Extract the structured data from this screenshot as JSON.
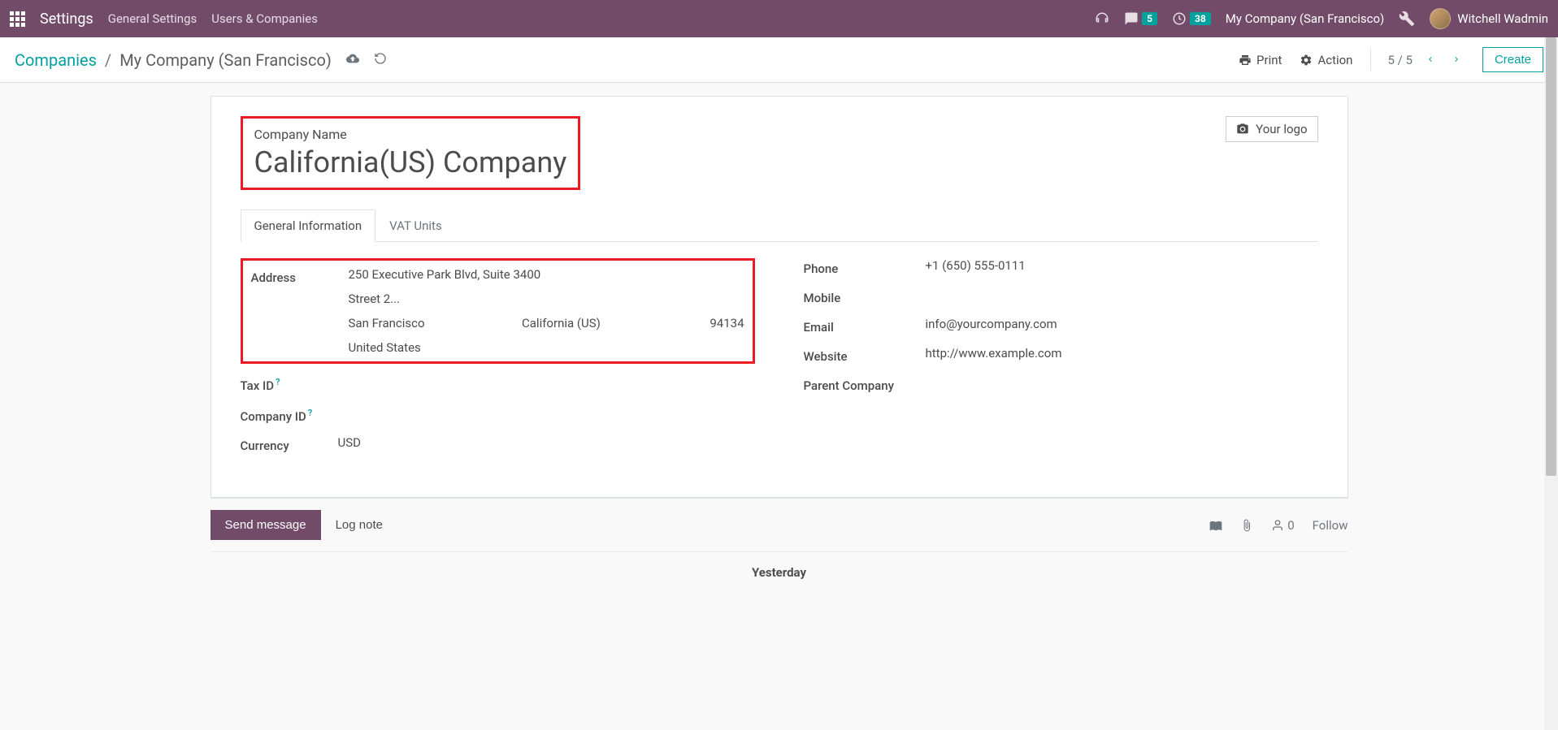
{
  "nav": {
    "app_title": "Settings",
    "links": [
      "General Settings",
      "Users & Companies"
    ],
    "messages_badge": "5",
    "activities_badge": "38",
    "company": "My Company (San Francisco)",
    "user": "Witchell Wadmin"
  },
  "controlPanel": {
    "breadcrumb_root": "Companies",
    "breadcrumb_current": "My Company (San Francisco)",
    "print": "Print",
    "action": "Action",
    "pager": "5 / 5",
    "create": "Create"
  },
  "form": {
    "logo_label": "Your logo",
    "name_label": "Company Name",
    "name_value": "California(US) Company",
    "tabs": [
      "General Information",
      "VAT Units"
    ],
    "left": {
      "address_label": "Address",
      "street1": "250 Executive Park Blvd, Suite 3400",
      "street2_placeholder": "Street 2...",
      "city": "San Francisco",
      "state": "California (US)",
      "zip": "94134",
      "country": "United States",
      "tax_id_label": "Tax ID",
      "company_id_label": "Company ID",
      "currency_label": "Currency",
      "currency_value": "USD"
    },
    "right": {
      "phone_label": "Phone",
      "phone_value": "+1 (650) 555-0111",
      "mobile_label": "Mobile",
      "email_label": "Email",
      "email_value": "info@yourcompany.com",
      "website_label": "Website",
      "website_value": "http://www.example.com",
      "parent_label": "Parent Company"
    }
  },
  "chatter": {
    "send": "Send message",
    "log": "Log note",
    "followers": "0",
    "follow": "Follow",
    "date_header": "Yesterday"
  }
}
